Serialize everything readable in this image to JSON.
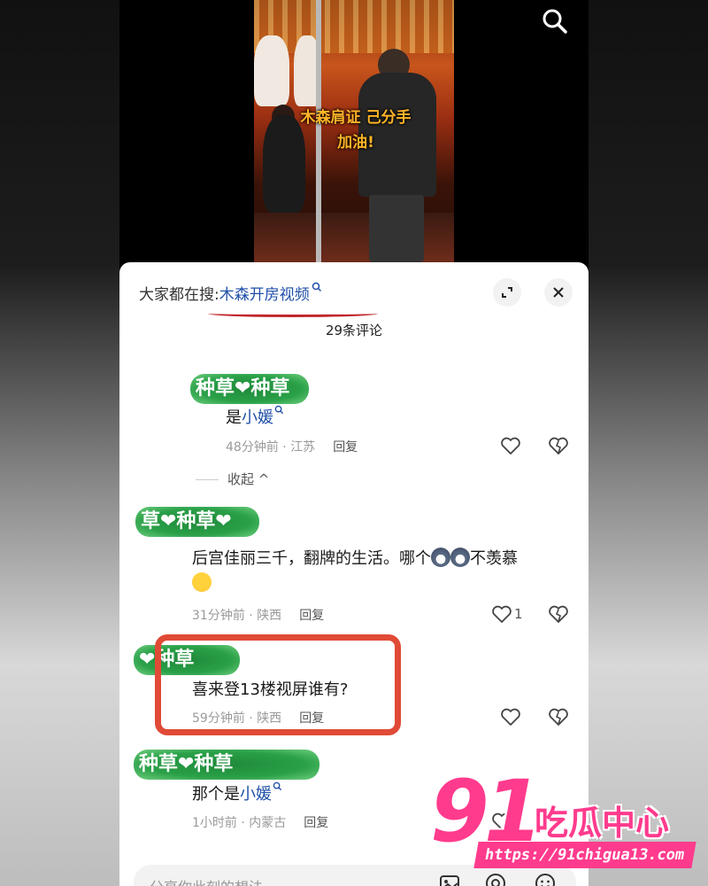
{
  "video": {
    "overlay_line1": "木森肩证 己分手",
    "overlay_line2": "加油!"
  },
  "sheet": {
    "search_prefix": "大家都在搜:",
    "search_keyword": "木森开房视频",
    "comment_count": "29条评论",
    "collapse_label": "收起"
  },
  "comments": [
    {
      "nickname": "种草❤种草",
      "text_prefix": "是",
      "text_link": "小媛",
      "time": "48分钟前",
      "location": "江苏",
      "reply": "回复",
      "likes": ""
    },
    {
      "nickname": "草❤种草❤",
      "text": "后宫佳丽三千，翻牌的生活。哪个",
      "text_tail": "不羡慕",
      "time": "31分钟前",
      "location": "陕西",
      "reply": "回复",
      "likes": "1"
    },
    {
      "nickname": "❤种草",
      "text": "喜来登13楼视屏谁有?",
      "time": "59分钟前",
      "location": "陕西",
      "reply": "回复",
      "likes": ""
    },
    {
      "nickname": "种草❤种草",
      "text_prefix": "那个是",
      "text_link": "小媛",
      "time": "1小时前",
      "location": "内蒙古",
      "reply": "回复",
      "likes": "1"
    }
  ],
  "input": {
    "placeholder": "分享你此刻的想法"
  },
  "watermark": {
    "number": "91",
    "name": "吃瓜中心",
    "url": "https://91chigua13.com"
  },
  "colors": {
    "link": "#1f4fa8",
    "highlight_box": "#e04a36",
    "watermark": "#ff3b8d",
    "nickname_mask": "#2aa048"
  },
  "icons": [
    "search-icon",
    "expand-icon",
    "close-icon",
    "like-icon",
    "dislike-icon",
    "image-icon",
    "at-icon",
    "emoji-icon",
    "search-mini-icon"
  ]
}
